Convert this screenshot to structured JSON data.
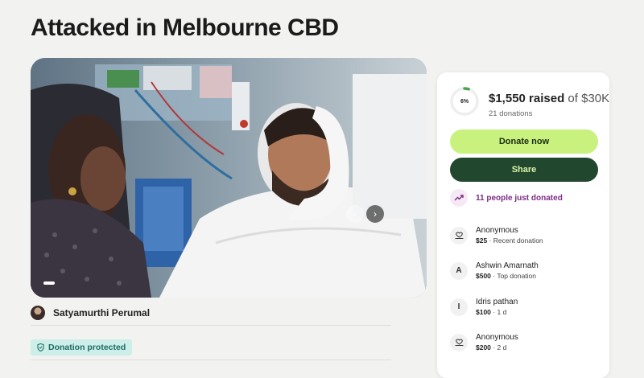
{
  "page": {
    "title": "Attacked in Melbourne CBD"
  },
  "media": {
    "photo_subject": "hospital-patient-photo",
    "prev_icon": "chevron-left-icon",
    "next_icon": "chevron-right-icon",
    "prev_glyph": "‹",
    "next_glyph": "›"
  },
  "organizer": {
    "name": "Satyamurthi Perumal"
  },
  "badge": {
    "label": "Donation protected",
    "icon": "shield-icon"
  },
  "fundraiser": {
    "progress_label": "6%",
    "progress_fraction": 0.052,
    "raised": "$1,550 raised",
    "goal": "of $30K",
    "donations": "21 donations",
    "donate_label": "Donate now",
    "share_label": "Share",
    "trend_text": "11 people just donated",
    "trend_icon": "trending-up-icon"
  },
  "donors": [
    {
      "name": "Anonymous",
      "amount": "$25",
      "note": " · Recent donation",
      "icon": "heart-hand-icon"
    },
    {
      "name": "Ashwin Amarnath",
      "amount": "$500",
      "note": " · Top donation",
      "initial": "A"
    },
    {
      "name": "Idris pathan",
      "amount": "$100",
      "note": " · 1 d",
      "initial": "I"
    },
    {
      "name": "Anonymous",
      "amount": "$200",
      "note": " · 2 d",
      "icon": "heart-hand-icon"
    }
  ],
  "colors": {
    "accent_green": "#c8f27d",
    "dark_green": "#22472f",
    "trend_purple": "#7b2c83",
    "badge_teal": "#cdeee9"
  }
}
